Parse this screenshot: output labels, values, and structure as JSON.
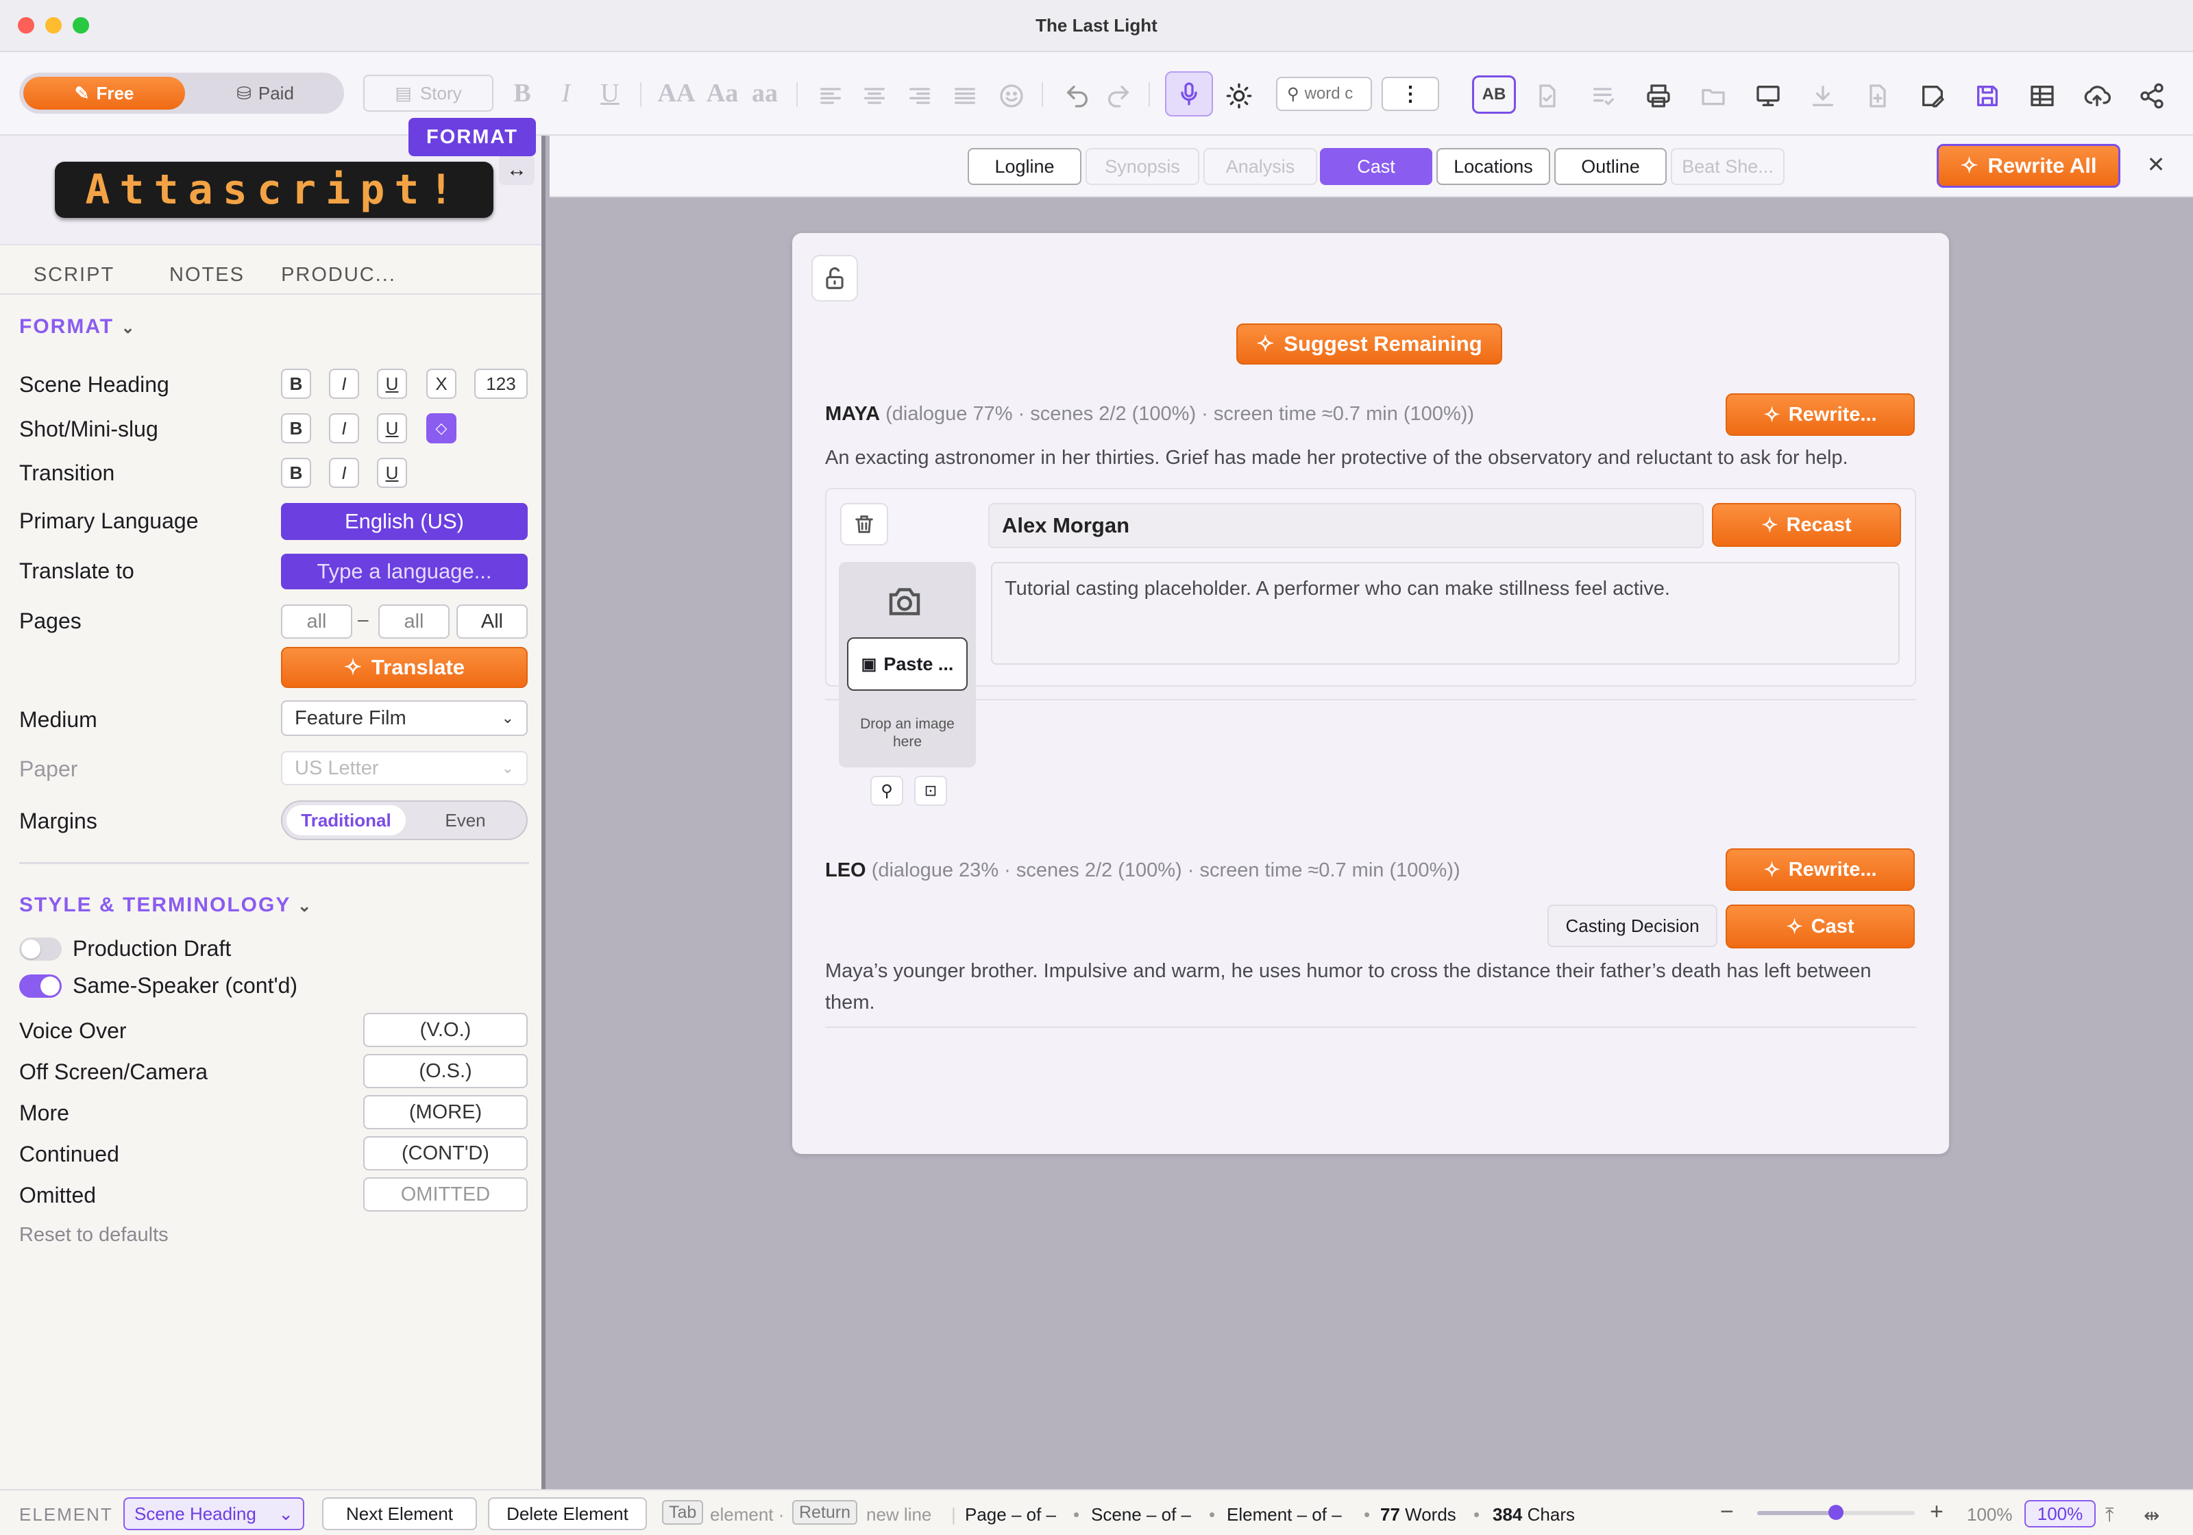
{
  "window": {
    "title": "The Last Light"
  },
  "toolbar": {
    "plan_free": "Free",
    "plan_paid": "Paid",
    "story_label": "Story",
    "bold": "B",
    "italic": "I",
    "underline": "U",
    "case_upper": "AA",
    "case_title": "Aa",
    "case_lower": "aa",
    "search_placeholder": "word c",
    "ab_label": "AB"
  },
  "sidebar": {
    "logo_text": "Attascript!",
    "tabs": [
      "SCRIPT",
      "NOTES",
      "PRODUC...",
      "FORMAT"
    ],
    "format_header": "FORMAT",
    "rows": {
      "scene_heading": "Scene Heading",
      "shot": "Shot/Mini-slug",
      "transition": "Transition",
      "primary_language": "Primary Language",
      "translate_to": "Translate to",
      "pages": "Pages",
      "medium": "Medium",
      "paper": "Paper",
      "margins": "Margins"
    },
    "btn_b": "B",
    "btn_i": "I",
    "btn_u": "U",
    "btn_x": "X",
    "btn_123": "123",
    "primary_language_value": "English (US)",
    "translate_placeholder": "Type a language...",
    "pages_from": "all",
    "pages_dash": "–",
    "pages_to": "all",
    "pages_all": "All",
    "translate_button": "Translate",
    "medium_value": "Feature Film",
    "paper_value": "US Letter",
    "margins_options": [
      "Traditional",
      "Even"
    ],
    "style_header": "STYLE & TERMINOLOGY",
    "toggles": [
      {
        "label": "Production Draft",
        "on": false
      },
      {
        "label": "Same-Speaker (cont'd)",
        "on": true
      }
    ],
    "terms": [
      {
        "label": "Voice Over",
        "value": "(V.O.)"
      },
      {
        "label": "Off Screen/Camera",
        "value": "(O.S.)"
      },
      {
        "label": "More",
        "value": "(MORE)"
      },
      {
        "label": "Continued",
        "value": "(CONT'D)"
      },
      {
        "label": "Omitted",
        "value": "OMITTED"
      }
    ],
    "reset": "Reset to defaults"
  },
  "main": {
    "tabs": [
      "Logline",
      "Synopsis",
      "Analysis",
      "Cast",
      "Locations",
      "Outline",
      "Beat She..."
    ],
    "rewrite_all": "Rewrite All",
    "suggest_remaining": "Suggest Remaining",
    "characters": [
      {
        "name": "MAYA",
        "stats": "(dialogue 77% · scenes 2/2 (100%) · screen time ≈0.7 min (100%))",
        "rewrite": "Rewrite...",
        "description": "An exacting astronomer in her thirties. Grief has made her protective of the observatory and reluctant to ask for help.",
        "actor": "Alex Morgan",
        "recast": "Recast",
        "paste": "Paste ...",
        "drop_hint": "Drop an image here",
        "casting_note": "Tutorial casting placeholder. A performer who can make stillness feel active."
      },
      {
        "name": "LEO",
        "stats": "(dialogue 23% · scenes 2/2 (100%) · screen time ≈0.7 min (100%))",
        "rewrite": "Rewrite...",
        "casting_decision": "Casting Decision",
        "cast": "Cast",
        "description": "Maya’s younger brother. Impulsive and warm, he uses humor to cross the distance their father’s death has left between them."
      }
    ]
  },
  "status": {
    "element_label": "ELEMENT",
    "element_value": "Scene Heading",
    "next_element": "Next Element",
    "delete_element": "Delete Element",
    "tab_key": "Tab",
    "tab_hint": "element ·",
    "return_key": "Return",
    "return_hint": "new line",
    "page": "Page – of –",
    "scene": "Scene – of –",
    "element": "Element – of –",
    "words_num": "77",
    "words_label": "Words",
    "chars_num": "384",
    "chars_label": "Chars",
    "zoom_text": "100%",
    "zoom_box": "100%",
    "zoom_level": 0.5
  },
  "colors": {
    "accent_orange": "#f47a22",
    "accent_purple": "#6b3fe0"
  }
}
